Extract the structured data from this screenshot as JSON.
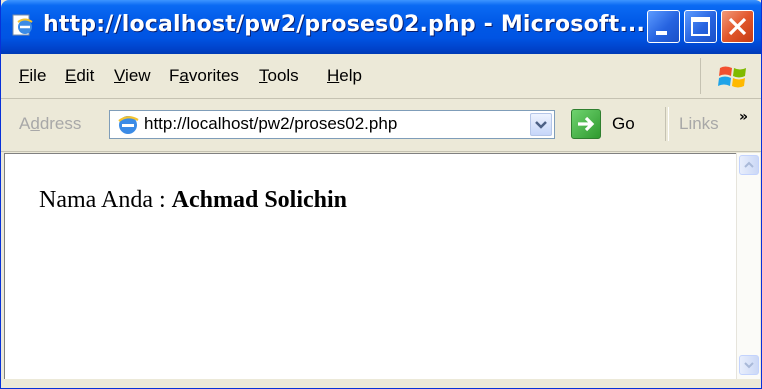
{
  "window": {
    "title": "http://localhost/pw2/proses02.php - Microsoft...",
    "title_icon": "ie-page-icon",
    "controls": [
      "minimize-icon",
      "maximize-icon",
      "close-icon"
    ]
  },
  "menubar": {
    "items": [
      {
        "key": "F",
        "rest": "ile"
      },
      {
        "key": "E",
        "rest": "dit"
      },
      {
        "key": "V",
        "rest": "iew"
      },
      {
        "pre": "F",
        "key": "a",
        "rest": "vorites"
      },
      {
        "key": "T",
        "rest": "ools"
      },
      {
        "key": "H",
        "rest": "elp"
      }
    ],
    "logo": "windows-flag-icon"
  },
  "addressbar": {
    "label_pre": "A",
    "label_key": "d",
    "label_rest": "dress",
    "url": "http://localhost/pw2/proses02.php",
    "go_label": "Go",
    "links_label": "Links",
    "chevron": "»"
  },
  "content": {
    "label": "Nama Anda : ",
    "value": "Achmad Solichin"
  },
  "colors": {
    "titlebar": "#0054E3",
    "chrome": "#ECE9D8",
    "close_button": "#E2572C"
  }
}
